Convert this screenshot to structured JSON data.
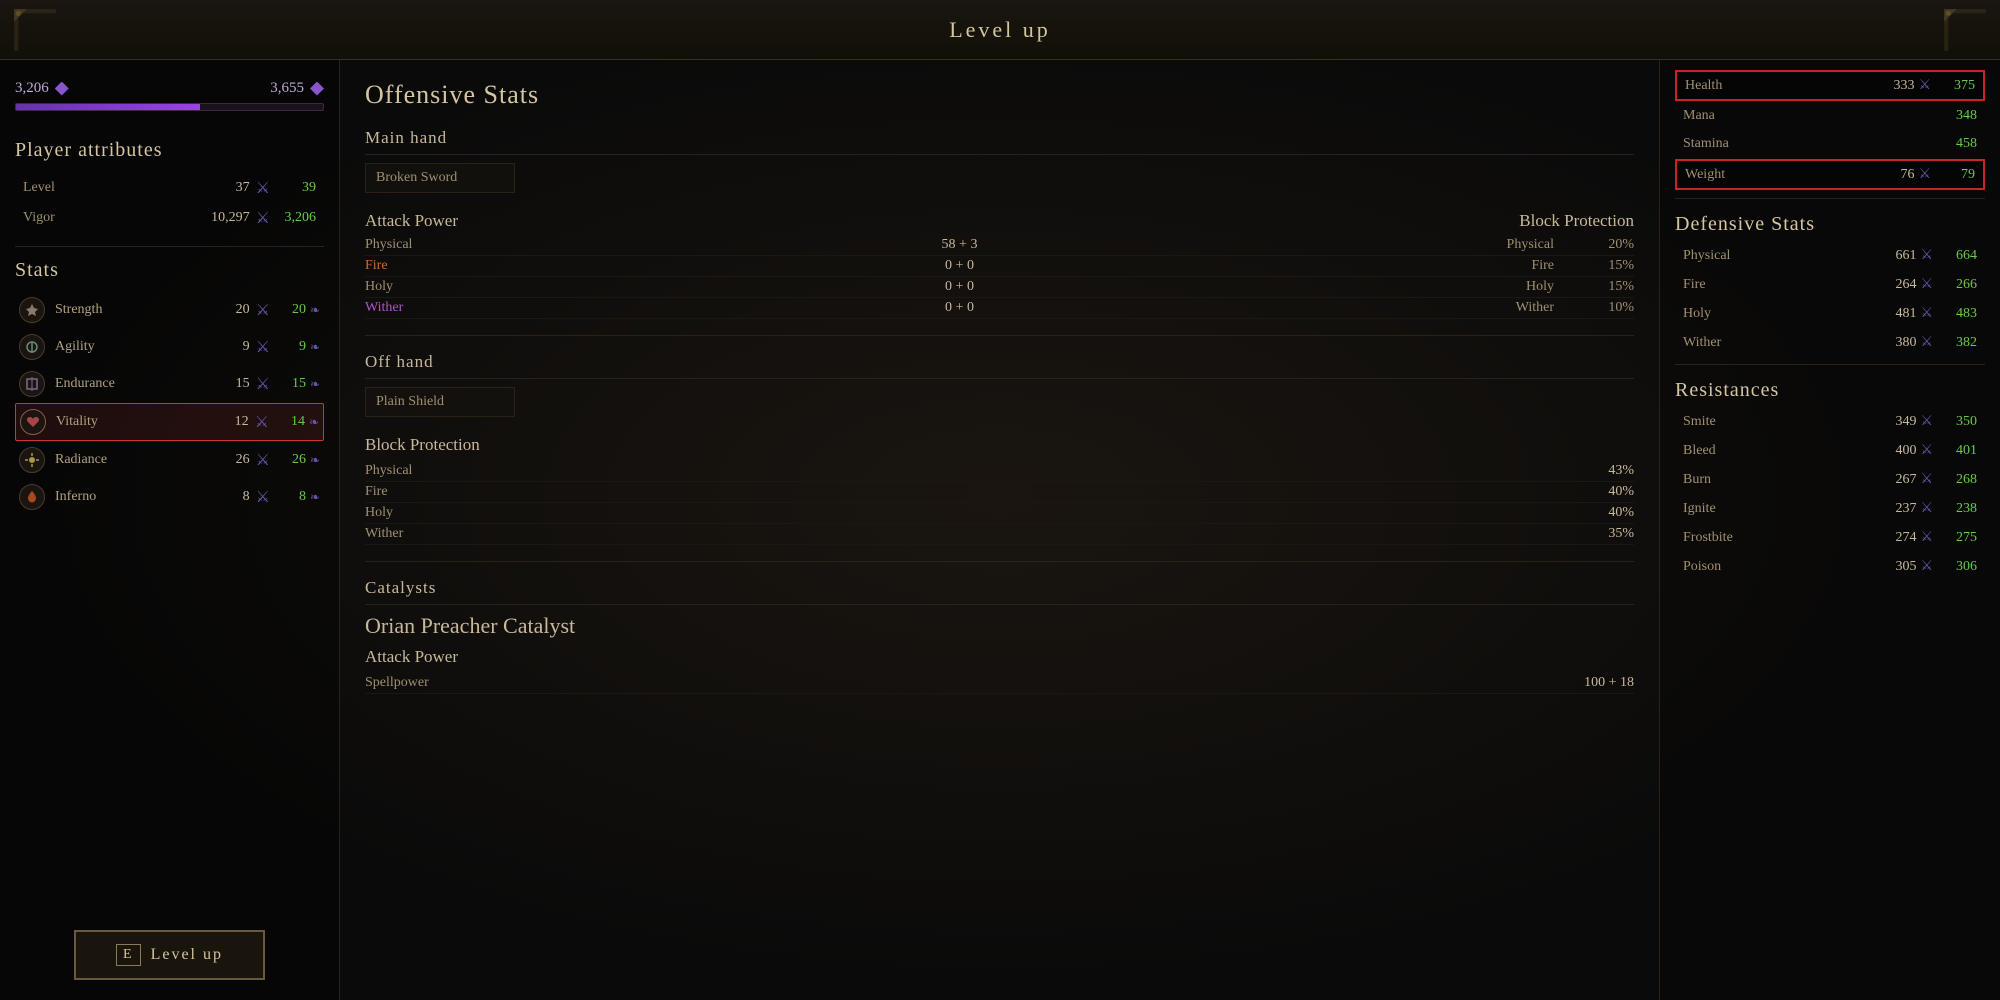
{
  "title": "Level up",
  "topBar": {
    "title": "Level up"
  },
  "leftPanel": {
    "vigorBar": {
      "leftValue": "3,206",
      "leftGem": "◆",
      "rightValue": "3,655",
      "rightGem": "◆",
      "fillPercent": 60
    },
    "playerAttributes": {
      "sectionTitle": "Player attributes",
      "rows": [
        {
          "label": "Level",
          "value": "37",
          "newValue": "39"
        },
        {
          "label": "Vigor",
          "value": "10,297",
          "newValue": "3,206"
        }
      ]
    },
    "stats": {
      "sectionTitle": "Stats",
      "rows": [
        {
          "name": "Strength",
          "value": "20",
          "newValue": "20",
          "highlighted": false,
          "iconColor": "#8a7a6a"
        },
        {
          "name": "Agility",
          "value": "9",
          "newValue": "9",
          "highlighted": false,
          "iconColor": "#6a8a7a"
        },
        {
          "name": "Endurance",
          "value": "15",
          "newValue": "15",
          "highlighted": false,
          "iconColor": "#7a6a8a"
        },
        {
          "name": "Vitality",
          "value": "12",
          "newValue": "14",
          "highlighted": true,
          "iconColor": "#8a6a5a"
        },
        {
          "name": "Radiance",
          "value": "26",
          "newValue": "26",
          "highlighted": false,
          "iconColor": "#7a8a6a"
        },
        {
          "name": "Inferno",
          "value": "8",
          "newValue": "8",
          "highlighted": false,
          "iconColor": "#8a6a4a"
        }
      ]
    },
    "levelUpButton": {
      "keyLabel": "E",
      "label": "Level up"
    }
  },
  "middlePanel": {
    "title": "Offensive Stats",
    "mainHand": {
      "sectionLabel": "Main hand",
      "itemName": "Broken Sword",
      "attackPower": {
        "label": "Attack Power",
        "blockProtection": {
          "label": "Block Protection"
        },
        "rows": [
          {
            "label": "Physical",
            "value": "58 + 3",
            "blockLabel": "Physical",
            "blockValue": "20%"
          },
          {
            "label": "Fire",
            "value": "0 + 0",
            "blockLabel": "Fire",
            "blockValue": "15%",
            "labelColor": "fire"
          },
          {
            "label": "Holy",
            "value": "0 + 0",
            "blockLabel": "Holy",
            "blockValue": "15%"
          },
          {
            "label": "Wither",
            "value": "0 + 0",
            "blockLabel": "Wither",
            "blockValue": "10%",
            "labelColor": "wither"
          }
        ]
      }
    },
    "offHand": {
      "sectionLabel": "Off hand",
      "itemName": "Plain Shield",
      "blockProtection": {
        "label": "Block Protection",
        "rows": [
          {
            "label": "Physical",
            "value": "43%"
          },
          {
            "label": "Fire",
            "value": "40%"
          },
          {
            "label": "Holy",
            "value": "40%"
          },
          {
            "label": "Wither",
            "value": "35%"
          }
        ]
      }
    },
    "catalysts": {
      "sectionLabel": "Catalysts",
      "itemName": "Orian Preacher Catalyst",
      "attackPower": {
        "label": "Attack Power",
        "rows": [
          {
            "label": "Spellpower",
            "value": "100 + 18"
          }
        ]
      }
    }
  },
  "rightPanel": {
    "vitals": {
      "rows": [
        {
          "label": "Health",
          "oldValue": "333",
          "newValue": "375",
          "highlighted": true
        },
        {
          "label": "Mana",
          "oldValue": "",
          "newValue": "348",
          "highlighted": false
        },
        {
          "label": "Stamina",
          "oldValue": "",
          "newValue": "458",
          "highlighted": false
        },
        {
          "label": "Weight",
          "oldValue": "76",
          "newValue": "79",
          "highlighted": true
        }
      ]
    },
    "defensiveStats": {
      "title": "Defensive Stats",
      "rows": [
        {
          "label": "Physical",
          "oldValue": "661",
          "newValue": "664"
        },
        {
          "label": "Fire",
          "oldValue": "264",
          "newValue": "266"
        },
        {
          "label": "Holy",
          "oldValue": "481",
          "newValue": "483"
        },
        {
          "label": "Wither",
          "oldValue": "380",
          "newValue": "382"
        }
      ]
    },
    "resistances": {
      "title": "Resistances",
      "rows": [
        {
          "label": "Smite",
          "oldValue": "349",
          "newValue": "350"
        },
        {
          "label": "Bleed",
          "oldValue": "400",
          "newValue": "401"
        },
        {
          "label": "Burn",
          "oldValue": "267",
          "newValue": "268"
        },
        {
          "label": "Ignite",
          "oldValue": "237",
          "newValue": "238"
        },
        {
          "label": "Frostbite",
          "oldValue": "274",
          "newValue": "275"
        },
        {
          "label": "Poison",
          "oldValue": "305",
          "newValue": "306"
        }
      ]
    }
  }
}
